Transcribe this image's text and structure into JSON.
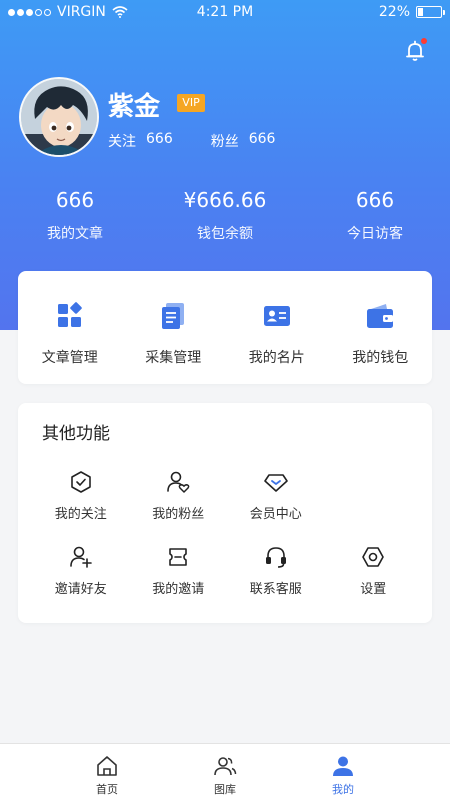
{
  "status_bar": {
    "carrier": "VIRGIN",
    "time": "4:21 PM",
    "battery": "22%",
    "battery_level": 0.22,
    "signal_icon": "signal-dots-icon",
    "wifi_icon": "wifi-icon"
  },
  "header": {
    "notification_icon": "bell-icon",
    "nickname": "紫金",
    "vip": "VIP",
    "following_label": "关注",
    "following_count": "666",
    "fans_label": "粉丝",
    "fans_count": "666"
  },
  "stats": [
    {
      "value": "666",
      "label": "我的文章"
    },
    {
      "value": "¥666.66",
      "label": "钱包余额"
    },
    {
      "value": "666",
      "label": "今日访客"
    }
  ],
  "main_actions": [
    {
      "label": "文章管理",
      "icon": "article-manage-icon"
    },
    {
      "label": "采集管理",
      "icon": "collect-manage-icon"
    },
    {
      "label": "我的名片",
      "icon": "business-card-icon"
    },
    {
      "label": "我的钱包",
      "icon": "wallet-icon"
    }
  ],
  "other": {
    "title": "其他功能",
    "items": [
      {
        "label": "我的关注",
        "icon": "follow-check-icon"
      },
      {
        "label": "我的粉丝",
        "icon": "fans-heart-icon"
      },
      {
        "label": "会员中心",
        "icon": "diamond-icon"
      },
      {
        "label": "邀请好友",
        "icon": "add-user-icon"
      },
      {
        "label": "我的邀请",
        "icon": "invite-ticket-icon"
      },
      {
        "label": "联系客服",
        "icon": "headset-icon"
      },
      {
        "label": "设置",
        "icon": "settings-hex-icon"
      }
    ]
  },
  "tabbar": [
    {
      "label": "首页",
      "icon": "home-icon"
    },
    {
      "label": "图库",
      "icon": "gallery-users-icon"
    },
    {
      "label": "我的",
      "icon": "profile-icon",
      "active": true
    }
  ],
  "colors": {
    "brand": "#3d73e6",
    "header_top": "#3e9bf5",
    "header_bottom": "#5374ee",
    "vip": "#f5a623",
    "notification_dot": "#ff3b30"
  }
}
